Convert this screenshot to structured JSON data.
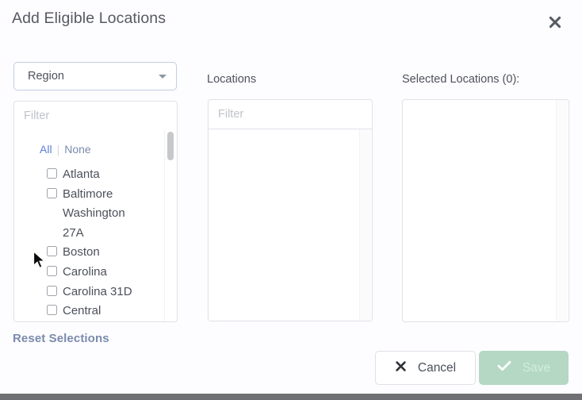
{
  "dialog": {
    "title": "Add Eligible Locations",
    "close_icon": "close-x-icon"
  },
  "region": {
    "selected": "Region",
    "caret_icon": "chevron-down-icon"
  },
  "left_panel": {
    "filter_placeholder": "Filter",
    "select_all_label": "All",
    "separator": "|",
    "select_none_label": "None",
    "options": [
      {
        "label": "Atlanta",
        "checked": false
      },
      {
        "label": "Baltimore\nWashington\n27A",
        "checked": false
      },
      {
        "label": "Boston",
        "checked": false
      },
      {
        "label": "Carolina",
        "checked": false
      },
      {
        "label": "Carolina 31D",
        "checked": false
      },
      {
        "label": "Central",
        "checked": false
      }
    ],
    "reset_label": "Reset Selections"
  },
  "middle_panel": {
    "heading": "Locations",
    "filter_placeholder": "Filter",
    "items": []
  },
  "right_panel": {
    "heading": "Selected Locations (0):",
    "items": []
  },
  "footer": {
    "cancel_label": "Cancel",
    "cancel_icon": "x-icon",
    "save_label": "Save",
    "save_icon": "check-icon",
    "save_disabled": true
  },
  "colors": {
    "page_background": "#fdfcfe",
    "title_text": "#565a63",
    "link_all": "#5b7fd6",
    "link_none": "#7b8bad",
    "reset_link": "#7b8bad",
    "select_border": "#c3cde2",
    "panel_border": "#e0e2e7",
    "save_button": "#b4d8c4",
    "save_text": "#d3ece0",
    "bottom_bar": "#6f7073"
  }
}
